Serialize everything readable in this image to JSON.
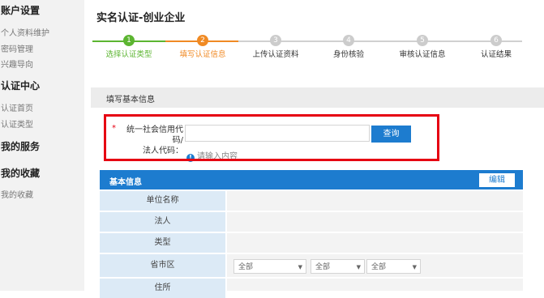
{
  "sidebar": {
    "sections": [
      {
        "title": "账户设置",
        "items": [
          "个人资料维护",
          "密码管理",
          "兴趣导向"
        ]
      },
      {
        "title": "认证中心",
        "items": [
          "认证首页",
          "认证类型"
        ]
      },
      {
        "title": "我的服务",
        "items": []
      },
      {
        "title": "我的收藏",
        "items": [
          "我的收藏"
        ]
      }
    ]
  },
  "page_title": "实名认证-创业企业",
  "steps": [
    {
      "num": "1",
      "label": "选择认证类型",
      "state": "done"
    },
    {
      "num": "2",
      "label": "填写认证信息",
      "state": "current"
    },
    {
      "num": "3",
      "label": "上传认证资料",
      "state": "todo"
    },
    {
      "num": "4",
      "label": "身份核验",
      "state": "todo"
    },
    {
      "num": "5",
      "label": "审核认证信息",
      "state": "todo"
    },
    {
      "num": "6",
      "label": "认证结果",
      "state": "todo"
    }
  ],
  "colors": {
    "done": "#5cb531",
    "current": "#f08a24",
    "todo": "#cccccc",
    "primary": "#1d7ccf",
    "highlight": "#e60012"
  },
  "section_title": "填写基本信息",
  "form": {
    "required_mark": "*",
    "label_line1": "统一社会信用代码/",
    "label_line2": "法人代码：",
    "value": "",
    "query_button": "查询",
    "hint": "请输入内容"
  },
  "info_table": {
    "title": "基本信息",
    "edit_button": "编辑",
    "rows": [
      "单位名称",
      "法人",
      "类型",
      "省市区",
      "住所"
    ],
    "region_selects": [
      "全部",
      "全部",
      "全部"
    ]
  }
}
